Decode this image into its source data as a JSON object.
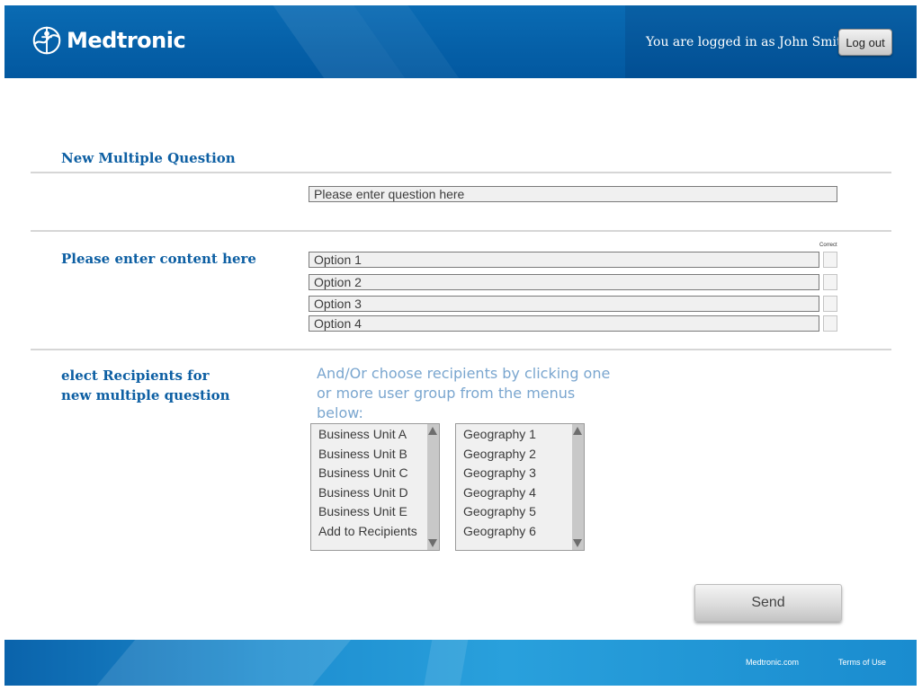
{
  "header": {
    "brand": "Medtronic",
    "logged_in_text": "You are logged in as John Smith",
    "logout_label": "Log out"
  },
  "question_section": {
    "title": "New Multiple Question",
    "question_placeholder": "Please enter question here"
  },
  "content_section": {
    "title": "Please enter content here",
    "correct_label": "Correct",
    "options": [
      "Option 1",
      "Option 2",
      "Option 3",
      "Option 4"
    ]
  },
  "recipients_section": {
    "title_line1": "elect Recipients for",
    "title_line2": "new multiple question",
    "hint": "And/Or choose recipients by clicking one or more user group from the menus below:",
    "business_units": [
      "Business Unit A",
      "Business Unit B",
      "Business Unit C",
      "Business Unit D",
      "Business Unit E",
      "Add to Recipients"
    ],
    "geographies": [
      "Geography 1",
      "Geography 2",
      "Geography 3",
      "Geography 4",
      "Geography 5",
      "Geography 6"
    ]
  },
  "send_label": "Send",
  "footer": {
    "site_link": "Medtronic.com",
    "terms_link": "Terms of Use"
  },
  "colors": {
    "header_blue": "#0258a0",
    "title_blue": "#0d5fa3",
    "hint_blue": "#7aa6cf",
    "footer_blue": "#29a0dc"
  }
}
